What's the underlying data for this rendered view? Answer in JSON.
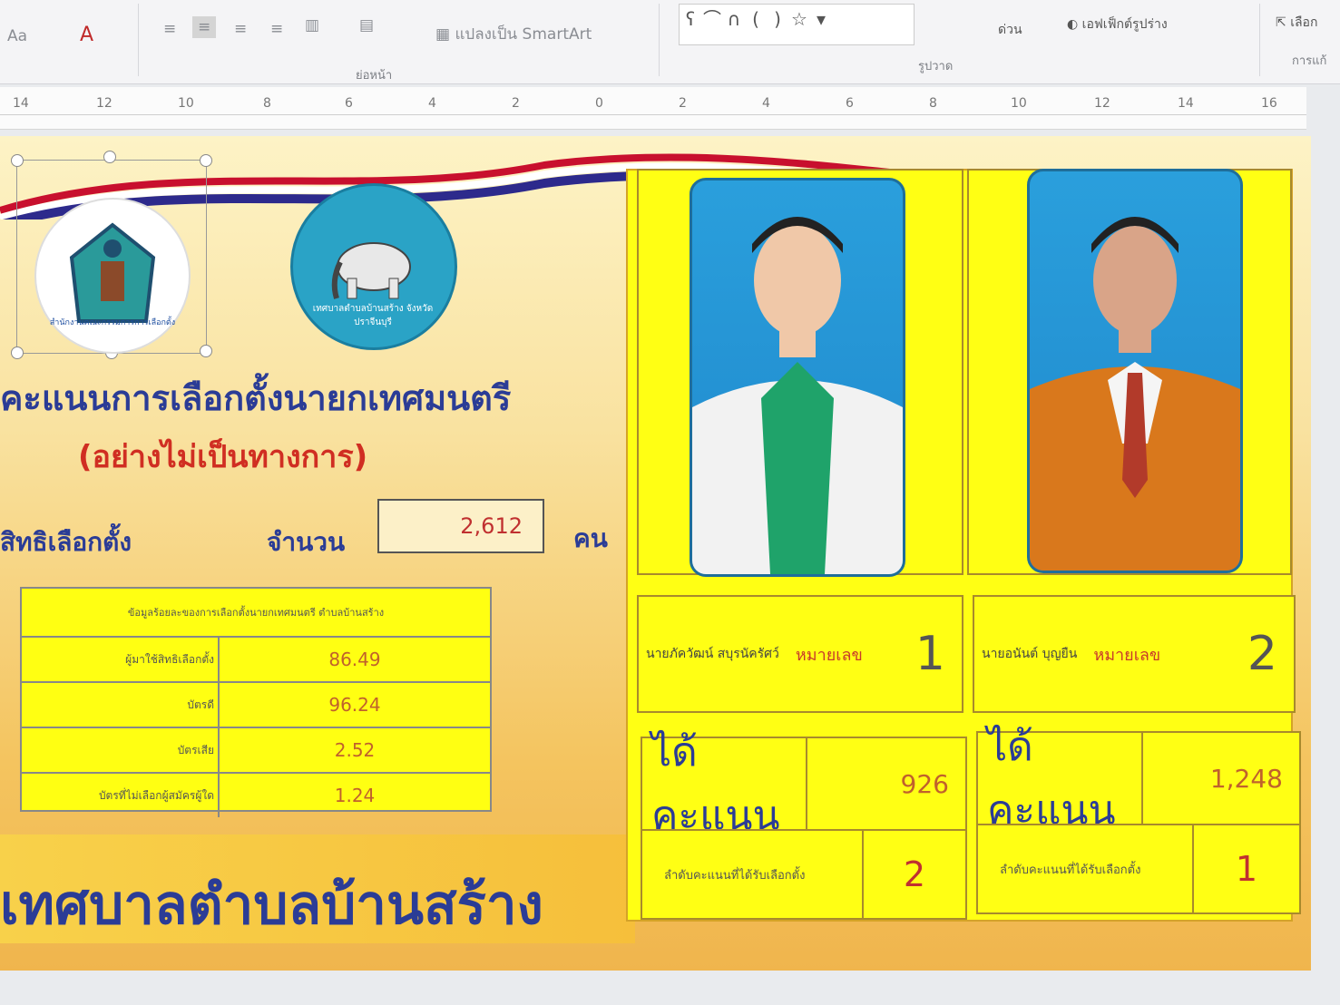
{
  "ribbon": {
    "font_size_btn": "Aa",
    "font_color_btn": "A",
    "smartart_label": "แปลงเป็น SmartArt",
    "paragraph_group": "ย่อหน้า",
    "drawing_group": "รูปวาด",
    "arrange_label": "ด่วน",
    "shape_effects_label": "เอฟเฟ็กต์รูปร่าง",
    "select_label": "เลือก",
    "edit_group": "การแก้"
  },
  "ruler": {
    "ticks": [
      "14",
      "12",
      "10",
      "8",
      "6",
      "4",
      "2",
      "0",
      "2",
      "4",
      "6",
      "8",
      "10",
      "12",
      "14",
      "16"
    ]
  },
  "slide": {
    "logo1_text": "สำนักงานคณะกรรมการการเลือกตั้ง",
    "logo2_text": "เทศบาลตำบลบ้านสร้าง จังหวัดปราจีนบุรี",
    "title": "คะแนนการเลือกตั้งนายกเทศมนตรี",
    "subtitle": "(อย่างไม่เป็นทางการ)",
    "eligible_label": "สิทธิเลือกตั้ง",
    "count_label": "จำนวน",
    "count_value": "2,612",
    "count_unit": "คน",
    "stats_header": "ข้อมูลร้อยละของการเลือกตั้งนายกเทศมนตรี ตำบลบ้านสร้าง",
    "stats": [
      {
        "label": "ผู้มาใช้สิทธิเลือกตั้ง",
        "value": "86.49"
      },
      {
        "label": "บัตรดี",
        "value": "96.24"
      },
      {
        "label": "บัตรเสีย",
        "value": "2.52"
      },
      {
        "label": "บัตรที่ไม่เลือกผู้สมัครผู้ใด",
        "value": "1.24"
      }
    ],
    "footer_title": "เทศบาลตำบลบ้านสร้าง"
  },
  "candidates": [
    {
      "name": "นายภัควัฒน์ สบุรนัครัศว์",
      "number_label": "หมายเลข",
      "number": "1",
      "votes_label": "ได้คะแนน",
      "votes": "926",
      "rank_label": "ลำดับคะแนนที่ได้รับเลือกตั้ง",
      "rank": "2",
      "outfit_color": "#f2f2f2",
      "shirt_color": "#1fa36a"
    },
    {
      "name": "นายอนันต์ บุญยืน",
      "number_label": "หมายเลข",
      "number": "2",
      "votes_label": "ได้คะแนน",
      "votes": "1,248",
      "rank_label": "ลำดับคะแนนที่ได้รับเลือกตั้ง",
      "rank": "1",
      "outfit_color": "#d9781c",
      "shirt_color": "#f5f5f5"
    }
  ]
}
